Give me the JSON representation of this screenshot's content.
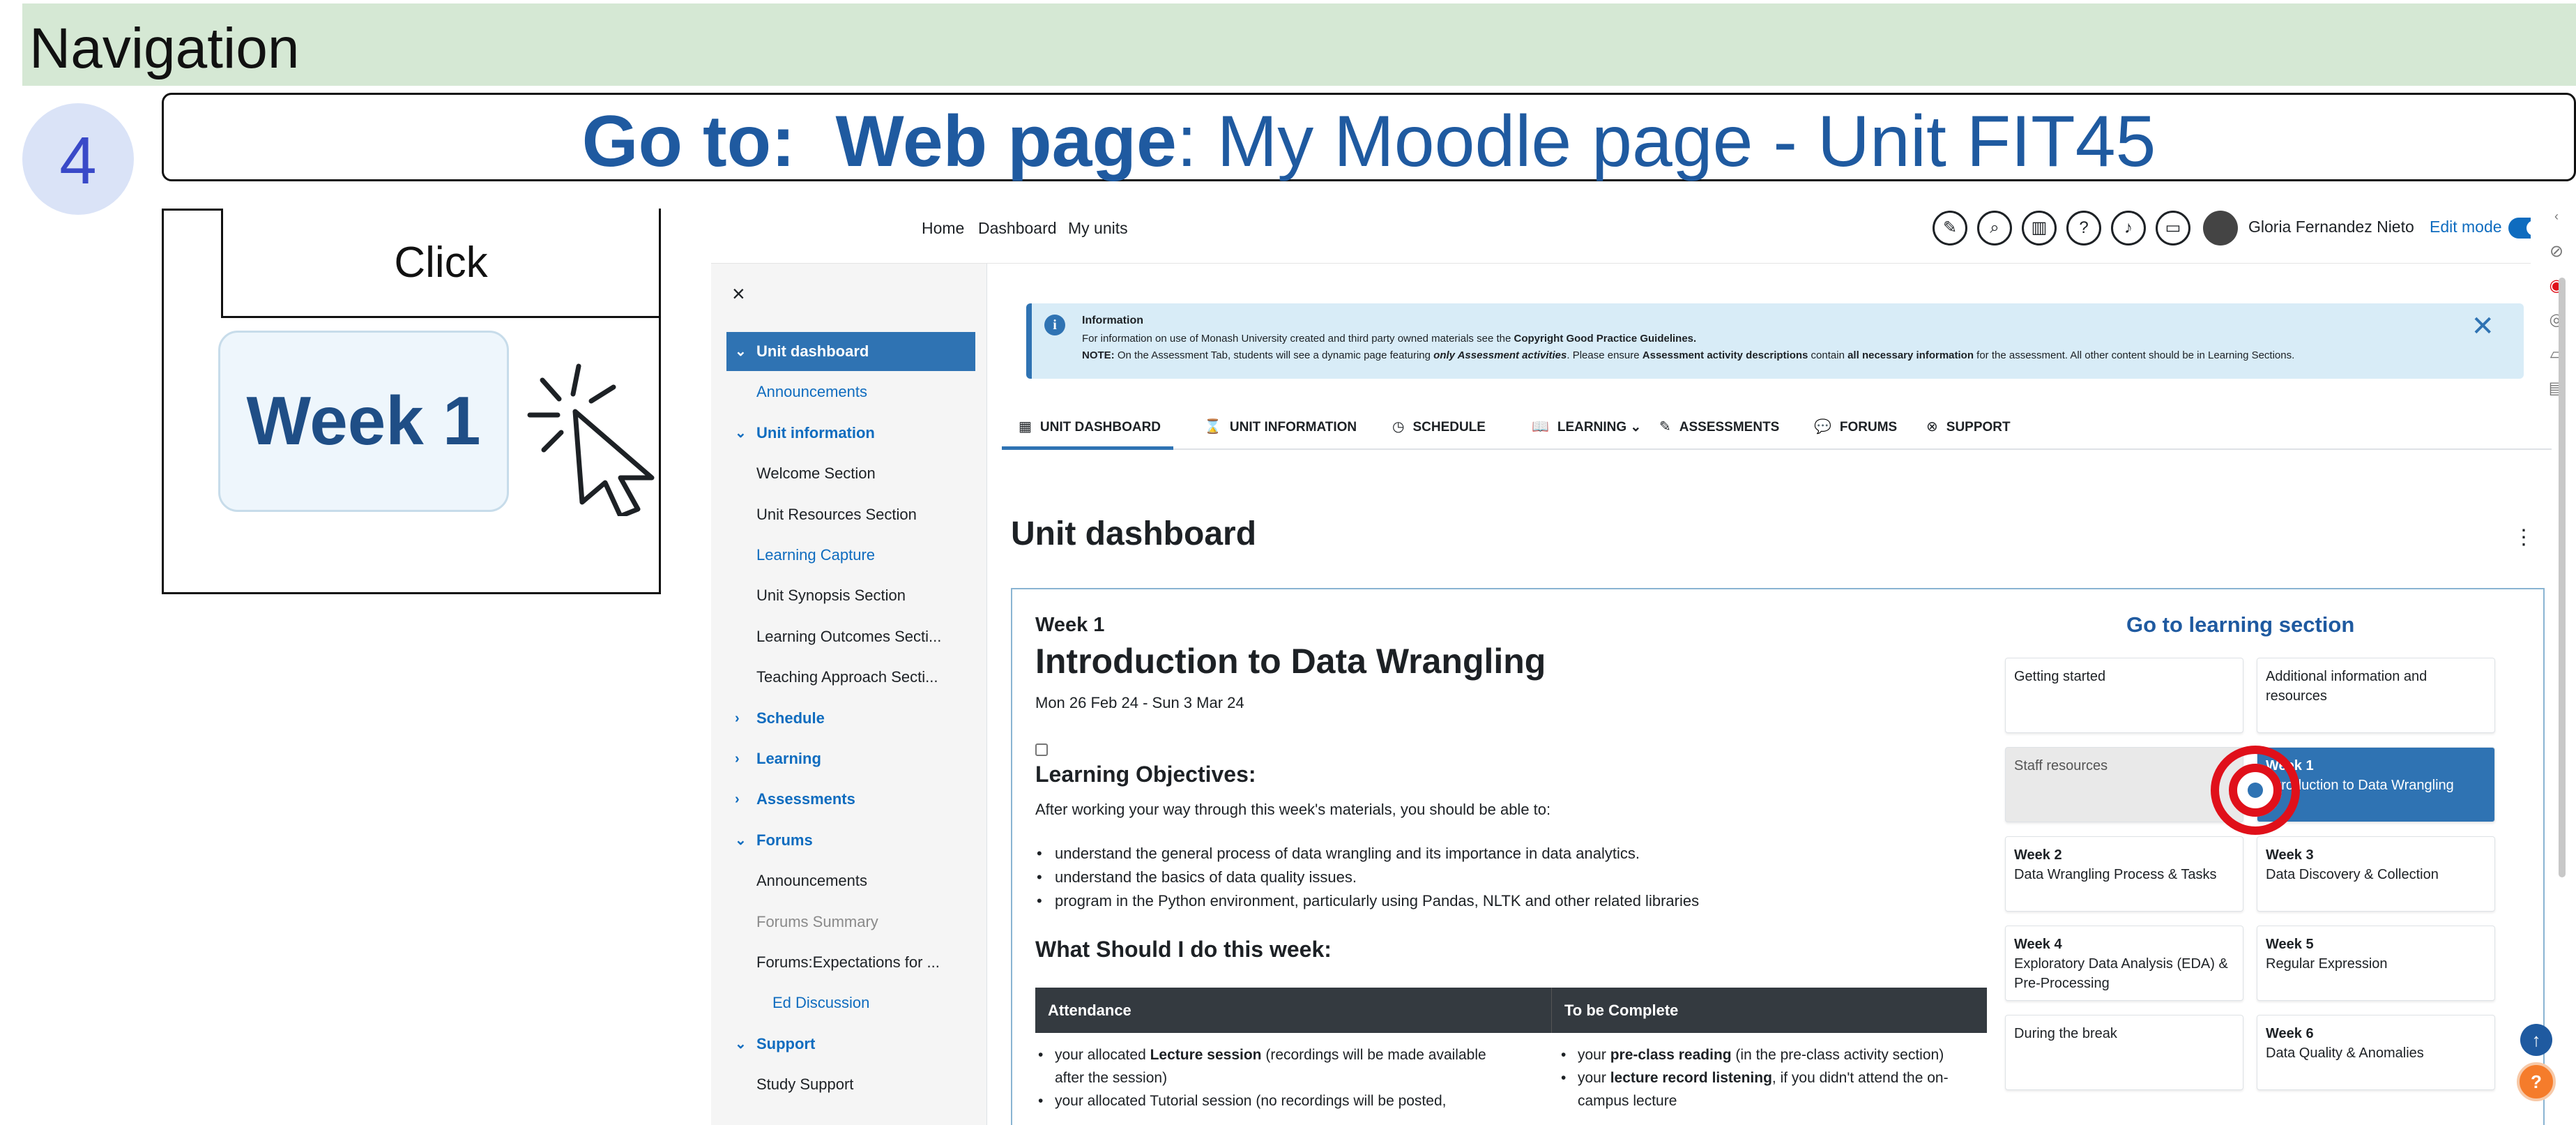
{
  "slide": {
    "header": "Navigation",
    "step_number": "4",
    "goto_prefix": "Go to:",
    "goto_bold": "Web page",
    "goto_rest": ": My Moodle page - Unit FIT45",
    "action_label": "Click",
    "target_label": "Week 1"
  },
  "topbar": {
    "nav": [
      "Home",
      "Dashboard",
      "My units"
    ],
    "icons": [
      "ink-icon",
      "search-icon",
      "book-icon",
      "help-icon",
      "bell-icon",
      "chat-icon"
    ],
    "user_name": "Gloria Fernandez Nieto",
    "edit_mode_label": "Edit mode"
  },
  "drawer": {
    "close": "×",
    "items": [
      {
        "label": "Unit dashboard",
        "kind": "active",
        "chevron": "⌄"
      },
      {
        "label": "Announcements",
        "kind": "link"
      },
      {
        "label": "Unit information",
        "kind": "sec",
        "chevron": "⌄"
      },
      {
        "label": "Welcome Section",
        "kind": "plain"
      },
      {
        "label": "Unit Resources Section",
        "kind": "plain"
      },
      {
        "label": "Learning Capture",
        "kind": "link"
      },
      {
        "label": "Unit Synopsis Section",
        "kind": "plain"
      },
      {
        "label": "Learning Outcomes Secti...",
        "kind": "plain"
      },
      {
        "label": "Teaching Approach Secti...",
        "kind": "plain"
      },
      {
        "label": "Schedule",
        "kind": "sec",
        "chevron": "›"
      },
      {
        "label": "Learning",
        "kind": "sec",
        "chevron": "›"
      },
      {
        "label": "Assessments",
        "kind": "sec",
        "chevron": "›"
      },
      {
        "label": "Forums",
        "kind": "sec",
        "chevron": "⌄"
      },
      {
        "label": "Announcements",
        "kind": "plain"
      },
      {
        "label": "Forums Summary",
        "kind": "muted"
      },
      {
        "label": "Forums:Expectations for ...",
        "kind": "plain"
      },
      {
        "label": "Ed Discussion",
        "kind": "link-sub"
      },
      {
        "label": "Support",
        "kind": "sec",
        "chevron": "⌄"
      },
      {
        "label": "Study Support",
        "kind": "plain"
      }
    ]
  },
  "info": {
    "title": "Information",
    "line1_a": "For information on use of Monash University created and third party owned materials see the ",
    "line1_b": "Copyright Good Practice Guidelines.",
    "line2_a": "NOTE:",
    "line2_b": " On the Assessment Tab, students will see a dynamic page featuring ",
    "line2_c": "only Assessment activities",
    "line2_d": ". Please ensure ",
    "line2_e": "Assessment activity descriptions",
    "line2_f": " contain ",
    "line2_g": "all necessary information",
    "line2_h": " for the assessment. All other content should be in Learning Sections.",
    "close": "✕"
  },
  "tabs": [
    {
      "icon": "▦",
      "label": "UNIT DASHBOARD"
    },
    {
      "icon": "⌛",
      "label": "UNIT INFORMATION"
    },
    {
      "icon": "◷",
      "label": "SCHEDULE"
    },
    {
      "icon": "📖",
      "label": "LEARNING ⌄"
    },
    {
      "icon": "✎",
      "label": "ASSESSMENTS"
    },
    {
      "icon": "💬",
      "label": "FORUMS"
    },
    {
      "icon": "⊗",
      "label": "SUPPORT"
    }
  ],
  "main": {
    "title": "Unit dashboard",
    "week_label": "Week 1",
    "week_title": "Introduction to Data Wrangling",
    "week_dates": "Mon 26 Feb 24 - Sun 3 Mar 24",
    "objectives_heading": "Learning Objectives:",
    "objectives_intro": "After working your way through this week's materials, you should be able to:",
    "objectives": [
      "understand the general process of data wrangling and its importance in data analytics.",
      "understand the basics of data quality issues.",
      "program in the Python environment, particularly using Pandas, NLTK and other related libraries"
    ],
    "todo_heading": "What Should I do this week:",
    "table": {
      "col1": "Attendance",
      "col2": "To be Complete",
      "c1_r1_a": "your allocated ",
      "c1_r1_b": "Lecture session",
      "c1_r1_c": " (recordings will be made available",
      "c1_r1_cont": "after the session)",
      "c1_r2": "your allocated Tutorial session (no recordings will be posted,",
      "c2_r1_a": "your ",
      "c2_r1_b": "pre-class reading",
      "c2_r1_c": " (in the pre-class activity section)",
      "c2_r2_a": "your ",
      "c2_r2_b": "lecture record listening",
      "c2_r2_c": ", if you didn't attend the on-",
      "c2_r2_cont": "campus lecture"
    }
  },
  "learning": {
    "heading": "Go to learning section",
    "cards": [
      {
        "title": "",
        "sub": "Getting started",
        "style": "plain"
      },
      {
        "title": "",
        "sub": "Additional information and resources",
        "style": "plain"
      },
      {
        "title": "",
        "sub": "Staff resources",
        "style": "grey"
      },
      {
        "title": "Week 1",
        "sub": "Introduction to Data Wrangling",
        "style": "blue"
      },
      {
        "title": "Week 2",
        "sub": "Data Wrangling Process & Tasks",
        "style": "plain"
      },
      {
        "title": "Week 3",
        "sub": "Data Discovery & Collection",
        "style": "plain"
      },
      {
        "title": "Week 4",
        "sub": "Exploratory Data Analysis (EDA) & Pre-Processing",
        "style": "plain"
      },
      {
        "title": "Week 5",
        "sub": "Regular Expression",
        "style": "plain"
      },
      {
        "title": "",
        "sub": "During the break",
        "style": "plain"
      },
      {
        "title": "Week 6",
        "sub": "Data Quality & Anomalies",
        "style": "plain"
      }
    ]
  },
  "fabs": {
    "up": "↑",
    "help": "?"
  },
  "colors": {
    "accent": "#2f73b3",
    "slide_title": "#1f5aa0",
    "nav_bar": "#d5e8d4",
    "target_ring": "#e0101a"
  }
}
